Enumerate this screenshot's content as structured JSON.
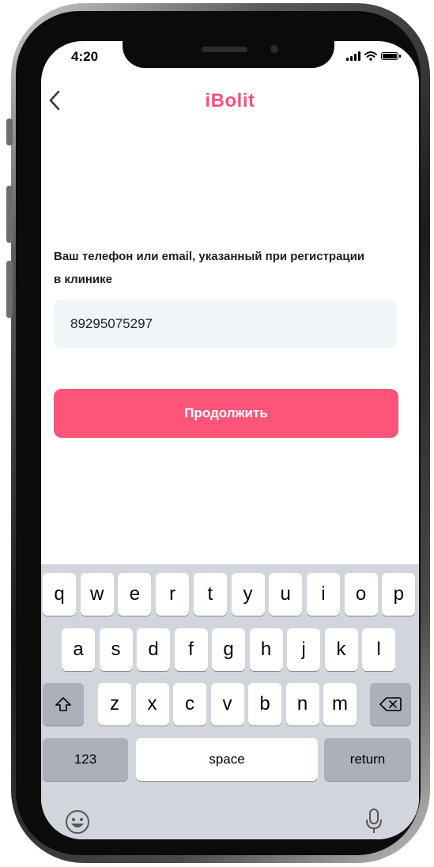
{
  "status_bar": {
    "time": "4:20"
  },
  "header": {
    "brand": "iBolit",
    "back_icon": "chevron-left-icon"
  },
  "form": {
    "label": "Ваш телефон или email, указанный при регистрации в клинике",
    "input_value": "89295075297",
    "submit_label": "Продолжить"
  },
  "keyboard": {
    "row1": [
      "q",
      "w",
      "e",
      "r",
      "t",
      "y",
      "u",
      "i",
      "o",
      "p"
    ],
    "row2": [
      "a",
      "s",
      "d",
      "f",
      "g",
      "h",
      "j",
      "k",
      "l"
    ],
    "row3": [
      "z",
      "x",
      "c",
      "v",
      "b",
      "n",
      "m"
    ],
    "numbers_label": "123",
    "space_label": "space",
    "return_label": "return",
    "icons": [
      "shift-icon",
      "backspace-icon",
      "emoji-icon",
      "microphone-icon"
    ]
  },
  "colors": {
    "accent": "#ff5479",
    "input_bg": "#f2f6f8",
    "keyboard_bg": "#d2d5db"
  }
}
